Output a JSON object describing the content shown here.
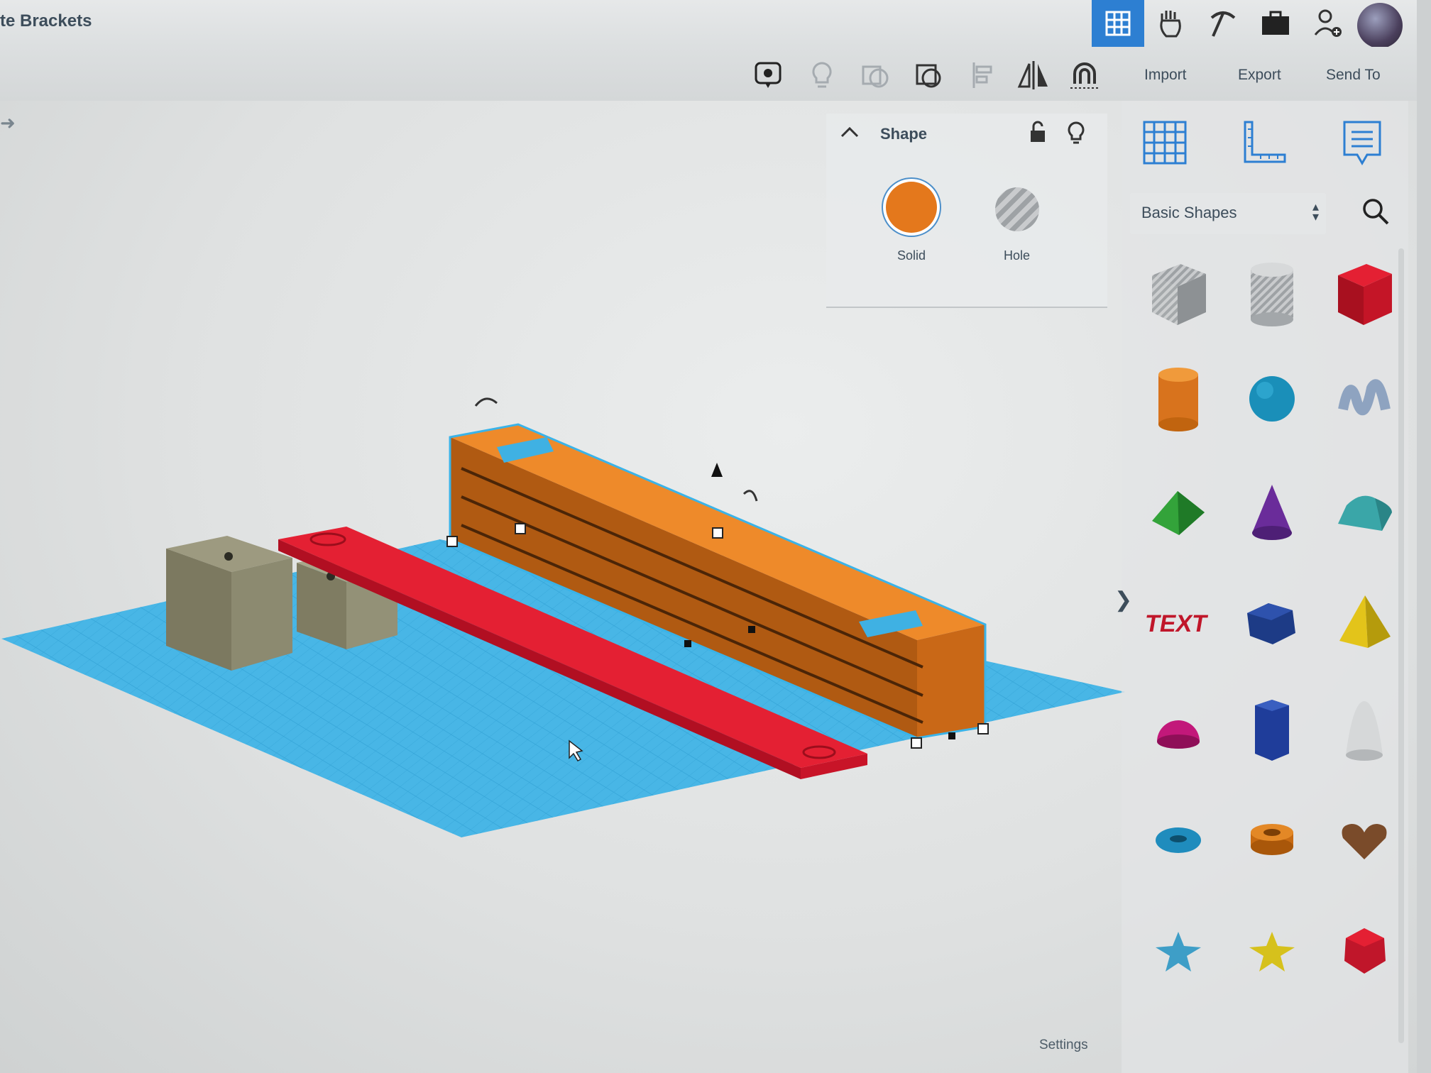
{
  "header": {
    "title": "te Brackets"
  },
  "top_icons": [
    "grid-view-icon",
    "tinker-hand-icon",
    "pickaxe-icon",
    "briefcase-icon",
    "add-user-icon"
  ],
  "toolbar": {
    "import_label": "Import",
    "export_label": "Export",
    "send_to_label": "Send To",
    "tools": [
      "comment-view-icon",
      "hint-bulb-icon",
      "group-icon",
      "ungroup-icon",
      "align-icon",
      "mirror-icon",
      "cruise-icon"
    ]
  },
  "shape_panel": {
    "title": "Shape",
    "solid_label": "Solid",
    "hole_label": "Hole",
    "solid_color": "#e4781c"
  },
  "library": {
    "category": "Basic Shapes",
    "view_icons": [
      "workplane-icon",
      "ruler-icon",
      "notes-icon"
    ],
    "shapes": [
      "box-hole",
      "cylinder-hole",
      "box",
      "cylinder",
      "sphere",
      "scribble",
      "roof",
      "cone",
      "round-roof",
      "text",
      "polygon",
      "pyramid",
      "half-sphere",
      "hexagonal-prism",
      "paraboloid",
      "torus",
      "tube",
      "heart",
      "star",
      "star-yellow",
      "icosahedron"
    ]
  },
  "footer": {
    "settings_label": "Settings"
  },
  "colors": {
    "accent": "#2d7fd2",
    "workplane": "#3fb1e3",
    "selected_shape": "#e4781c",
    "red_bar": "#d4142a",
    "grey_boxes": "#7f7c62"
  }
}
